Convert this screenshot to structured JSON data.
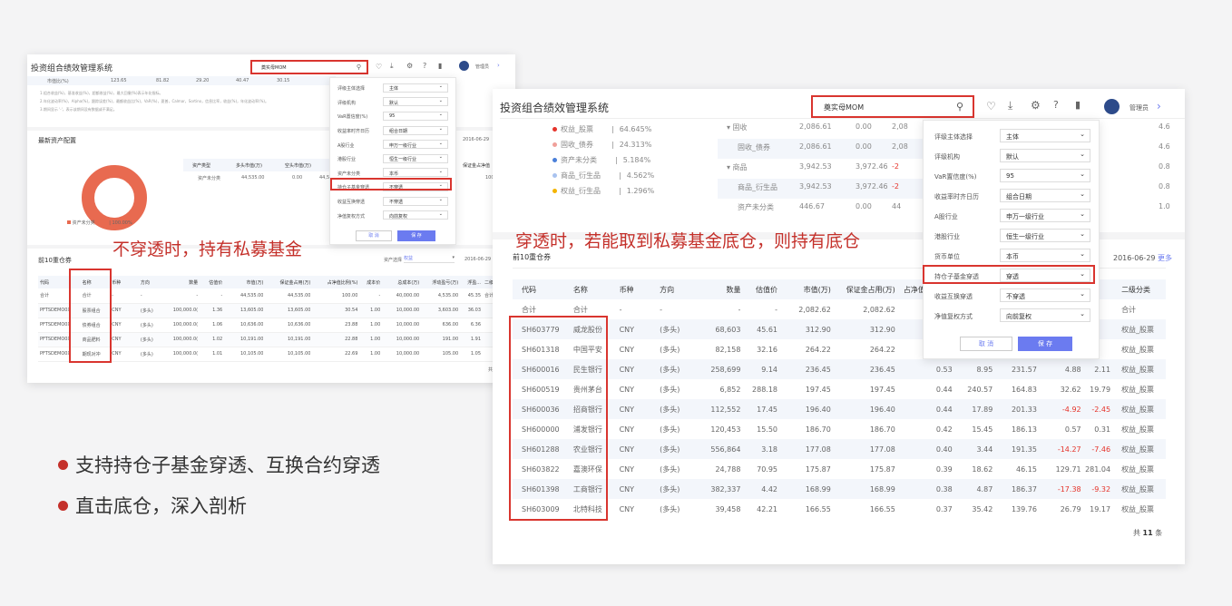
{
  "left": {
    "app_title": "投资组合绩效管理系统",
    "search_value": "奠实母MOM",
    "user": "管理员",
    "top_row": [
      "市值比(%)",
      "123.65",
      "81.82",
      "29.20",
      "40.47",
      "30.15"
    ],
    "notes": [
      "1.组合收益(%)，基准收益(%)，超额收益(%)，最大回撤(%)表示年化指标。",
      "2.年化波动率(%)，Alpha(%)，跟踪误差(%)，最额收益比(%)，VaR(%)，夏普，Calmar，Sortino，信息比率，收益(%)，年化波动率(%)。",
      "3.期间显示 '-'，表示该期间没有数据或不满足。"
    ],
    "asset_section": "最新资产配置",
    "asset_date": "2016-06-29",
    "pie_legend": "资产未分类",
    "pie_pct": "100.00%",
    "asset_table_headers": [
      "资产类型",
      "多头市值(万)",
      "空头市值(万)",
      "净值"
    ],
    "asset_table_row": [
      "资产未分类",
      "44,535.00",
      "0.00",
      "44,5"
    ],
    "asset_right_header": "保证金占净值",
    "asset_right_val": "100",
    "holdings_title": "前10重仓券",
    "holdings_filter_label": "资产选择",
    "holdings_filter_value": "权益",
    "holdings_date": "2016-06-29",
    "headers": [
      "代码",
      "名称",
      "币种",
      "方向",
      "数量",
      "估值价",
      "市值(万)",
      "保证金占用(万)",
      "占净值比例(%)",
      "成本价",
      "总成本(万)",
      "浮动盈亏(万)",
      "浮盈...",
      "二级分类"
    ],
    "rows": [
      [
        "合计",
        "合计",
        "-",
        "-",
        "-",
        "-",
        "44,535.00",
        "44,535.00",
        "100.00",
        "-",
        "40,000.00",
        "4,535.00",
        "45.35",
        "合计"
      ],
      [
        "PFTSDEMO0X",
        "股票组合",
        "CNY",
        "(多头)",
        "100,000.0(",
        "1.36",
        "13,605.00",
        "13,605.00",
        "30.54",
        "1.00",
        "10,000.00",
        "3,603.00",
        "36.03",
        ""
      ],
      [
        "PFTSDEMO0X",
        "债券组合",
        "CNY",
        "(多头)",
        "100,000.0(",
        "1.06",
        "10,636.00",
        "10,636.00",
        "23.88",
        "1.00",
        "10,000.00",
        "636.00",
        "6.36",
        ""
      ],
      [
        "PFTSDEMO0X",
        "商品肥料",
        "CNY",
        "(多头)",
        "100,000.0(",
        "1.02",
        "10,191.00",
        "10,191.00",
        "22.88",
        "1.00",
        "10,000.00",
        "191.00",
        "1.91",
        ""
      ],
      [
        "PFTSDEMO0X",
        "期现对冲",
        "CNY",
        "(多头)",
        "100,000.0(",
        "1.01",
        "10,105.00",
        "10,105.00",
        "22.69",
        "1.00",
        "10,000.00",
        "105.00",
        "1.05",
        ""
      ]
    ],
    "page_total": "共 5",
    "dropdown": [
      {
        "label": "评级主体选择",
        "value": "主体"
      },
      {
        "label": "评级机构",
        "value": "默认"
      },
      {
        "label": "VaR置信度(%)",
        "value": "95"
      },
      {
        "label": "收益率时齐日历",
        "value": "组合日期"
      },
      {
        "label": "A股行业",
        "value": "申万一级行业"
      },
      {
        "label": "港股行业",
        "value": "恒生一级行业"
      },
      {
        "label": "资产未分类",
        "value": "本币"
      },
      {
        "label": "持仓子基金穿透",
        "value": "不穿透"
      },
      {
        "label": "收益互换穿透",
        "value": "不穿透"
      },
      {
        "label": "净值复权方式",
        "value": "向前复权"
      }
    ],
    "cancel": "取 消",
    "ok": "保 存"
  },
  "right": {
    "app_title": "投资组合绩效管理系统",
    "search_value": "奠实母MOM",
    "user": "管理员",
    "legend": [
      {
        "name": "权益_股票",
        "pct": "64.645%",
        "color": "#e5332a"
      },
      {
        "name": "固收_债券",
        "pct": "24.313%",
        "color": "#f0a09a"
      },
      {
        "name": "资产未分类",
        "pct": "5.184%",
        "color": "#4a7fd9"
      },
      {
        "name": "商品_衍生品",
        "pct": "4.562%",
        "color": "#a9c3ef"
      },
      {
        "name": "权益_衍生品",
        "pct": "1.296%",
        "color": "#f4b400"
      }
    ],
    "top_table": [
      [
        "▾ 固收",
        "2,086.61",
        "0.00",
        "2,08"
      ],
      [
        "固收_债券",
        "2,086.61",
        "0.00",
        "2,08"
      ],
      [
        "▾ 商品",
        "3,942.53",
        "3,972.46",
        "-2"
      ],
      [
        "商品_衍生品",
        "3,942.53",
        "3,972.46",
        "-2"
      ],
      [
        "资产未分类",
        "446.67",
        "0.00",
        "44"
      ]
    ],
    "top_right_vals": [
      "4.6",
      "4.6",
      "0.8",
      "0.8",
      "1.0"
    ],
    "holdings_title": "前10重仓券",
    "holdings_date": "2016-06-29",
    "more": "更多",
    "headers": [
      "代码",
      "名称",
      "币种",
      "方向",
      "数量",
      "估值价",
      "市值(万)",
      "保证金占用(万)",
      "占净值比例(%)",
      "",
      "",
      "",
      "",
      "二级分类"
    ],
    "rows": [
      [
        "合计",
        "合计",
        "-",
        "-",
        "-",
        "-",
        "2,082.62",
        "2,082.62",
        "4.6",
        "",
        "",
        "",
        "",
        "合计"
      ],
      [
        "SH603779",
        "威龙股份",
        "CNY",
        "(多头)",
        "68,603",
        "45.61",
        "312.90",
        "312.90",
        "0.7",
        "",
        "",
        "",
        "",
        "权益_股票"
      ],
      [
        "SH601318",
        "中国平安",
        "CNY",
        "(多头)",
        "82,158",
        "32.16",
        "264.22",
        "264.22",
        "0.5",
        "",
        "",
        "",
        "",
        "权益_股票"
      ],
      [
        "SH600016",
        "民生银行",
        "CNY",
        "(多头)",
        "258,699",
        "9.14",
        "236.45",
        "236.45",
        "0.53",
        "8.95",
        "231.57",
        "4.88",
        "2.11",
        "权益_股票"
      ],
      [
        "SH600519",
        "贵州茅台",
        "CNY",
        "(多头)",
        "6,852",
        "288.18",
        "197.45",
        "197.45",
        "0.44",
        "240.57",
        "164.83",
        "32.62",
        "19.79",
        "权益_股票"
      ],
      [
        "SH600036",
        "招商银行",
        "CNY",
        "(多头)",
        "112,552",
        "17.45",
        "196.40",
        "196.40",
        "0.44",
        "17.89",
        "201.33",
        "-4.92",
        "-2.45",
        "权益_股票"
      ],
      [
        "SH600000",
        "浦发银行",
        "CNY",
        "(多头)",
        "120,453",
        "15.50",
        "186.70",
        "186.70",
        "0.42",
        "15.45",
        "186.13",
        "0.57",
        "0.31",
        "权益_股票"
      ],
      [
        "SH601288",
        "农业银行",
        "CNY",
        "(多头)",
        "556,864",
        "3.18",
        "177.08",
        "177.08",
        "0.40",
        "3.44",
        "191.35",
        "-14.27",
        "-7.46",
        "权益_股票"
      ],
      [
        "SH603822",
        "嘉澳环保",
        "CNY",
        "(多头)",
        "24,788",
        "70.95",
        "175.87",
        "175.87",
        "0.39",
        "18.62",
        "46.15",
        "129.71",
        "281.04",
        "权益_股票"
      ],
      [
        "SH601398",
        "工商银行",
        "CNY",
        "(多头)",
        "382,337",
        "4.42",
        "168.99",
        "168.99",
        "0.38",
        "4.87",
        "186.37",
        "-17.38",
        "-9.32",
        "权益_股票"
      ],
      [
        "SH603009",
        "北特科技",
        "CNY",
        "(多头)",
        "39,458",
        "42.21",
        "166.55",
        "166.55",
        "0.37",
        "35.42",
        "139.76",
        "26.79",
        "19.17",
        "权益_股票"
      ]
    ],
    "page_total_prefix": "共",
    "page_total_num": "11",
    "page_total_suffix": "条",
    "dropdown": [
      {
        "label": "评级主体选择",
        "value": "主体"
      },
      {
        "label": "评级机构",
        "value": "默认"
      },
      {
        "label": "VaR置信度(%)",
        "value": "95"
      },
      {
        "label": "收益率时齐日历",
        "value": "组合日期"
      },
      {
        "label": "A股行业",
        "value": "申万一级行业"
      },
      {
        "label": "港股行业",
        "value": "恒生一级行业"
      },
      {
        "label": "货币单位",
        "value": "本币"
      },
      {
        "label": "持仓子基金穿透",
        "value": "穿透"
      },
      {
        "label": "收益互换穿透",
        "value": "不穿透"
      },
      {
        "label": "净值复权方式",
        "value": "向前复权"
      }
    ],
    "cancel": "取 消",
    "ok": "保 存"
  },
  "labels": {
    "left_caption": "不穿透时，持有私募基金",
    "right_caption": "穿透时，若能取到私募基金底仓，则持有底仓"
  },
  "bullets": [
    "支持持仓子基金穿透、互换合约穿透",
    "直击底仓，深入剖析"
  ],
  "colors": {
    "accent": "#d9352f",
    "primary_btn": "#6b7bf0",
    "pie": "#e86a50"
  }
}
